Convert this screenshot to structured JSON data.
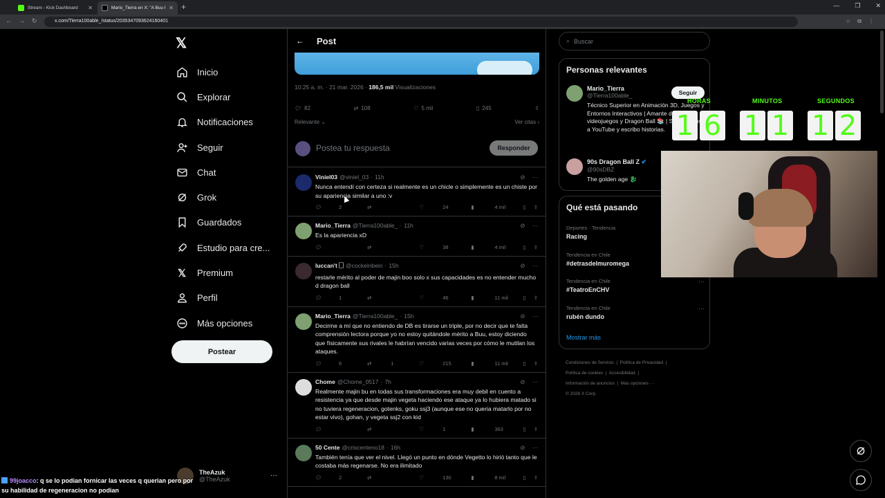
{
  "browser": {
    "tabs": [
      {
        "title": "Stream - Kick Dashboard",
        "favicon_color": "#53fc18"
      },
      {
        "title": "Mario_Tierra en X: \"A Buu le h",
        "favicon_color": "#000000"
      }
    ],
    "url": "x.com/Tierra100able_/status/2035347093624160401"
  },
  "nav": {
    "items": [
      {
        "label": "Inicio",
        "icon": "home-icon"
      },
      {
        "label": "Explorar",
        "icon": "search-icon"
      },
      {
        "label": "Notificaciones",
        "icon": "bell-icon"
      },
      {
        "label": "Seguir",
        "icon": "follow-icon"
      },
      {
        "label": "Chat",
        "icon": "mail-icon"
      },
      {
        "label": "Grok",
        "icon": "grok-icon"
      },
      {
        "label": "Guardados",
        "icon": "bookmark-icon"
      },
      {
        "label": "Estudio para cre...",
        "icon": "rocket-icon"
      },
      {
        "label": "Premium",
        "icon": "x-icon"
      },
      {
        "label": "Perfil",
        "icon": "person-icon"
      },
      {
        "label": "Más opciones",
        "icon": "more-circle-icon"
      }
    ],
    "post_button": "Postear",
    "profile": {
      "name": "TheAzuk",
      "handle": "@TheAzuk"
    }
  },
  "post": {
    "header": "Post",
    "time": "10:25 a. m. · 21 mar. 2026 · ",
    "views_count": "186,5 mil",
    "views_label": " Visualizaciones",
    "stats": {
      "replies": "82",
      "reposts": "108",
      "likes": "5 mil",
      "bookmarks": "245"
    },
    "sort": "Relevante",
    "quotes": "Ver citas",
    "reply_placeholder": "Postea tu respuesta",
    "reply_button": "Responder"
  },
  "replies": [
    {
      "name": "Viniel03",
      "handle": "@viniel_03",
      "time": "11h",
      "text": "Nunca entendí con certeza si realmente es un chicle o simplemente es un chiste por su apariencia similar a uno :v",
      "replies": "2",
      "reposts": "",
      "likes": "24",
      "views": "4 mil",
      "avatar_color": "#1a2a6a"
    },
    {
      "name": "Mario_Tierra",
      "handle": "@Tierra100able_",
      "time": "11h",
      "text": "Es la apariencia xD",
      "replies": "",
      "reposts": "",
      "likes": "38",
      "views": "4 mil",
      "avatar_color": "#7fa070"
    },
    {
      "name": "luccan't 🗌",
      "handle": "@cockeinbein",
      "time": "15h",
      "text": "restarle mérito al poder de majin boo solo x sus capacidades es no entender mucho d dragon ball",
      "replies": "1",
      "reposts": "",
      "likes": "46",
      "views": "11 mil",
      "avatar_color": "#3a2a30"
    },
    {
      "name": "Mario_Tierra",
      "handle": "@Tierra100able_",
      "time": "15h",
      "text": "Decirme a mí que no entiendo de DB es tirarse un triple, por no decir que te falta comprensión lectora porque yo no estoy quitándole mérito a Buu, estoy diciendo que físicamente sus rivales le habrían vencido varias veces por cómo le mutilan los ataques.",
      "replies": "6",
      "reposts": "1",
      "likes": "215",
      "views": "11 mil",
      "avatar_color": "#7fa070"
    },
    {
      "name": "Chome",
      "handle": "@Chome_0517",
      "time": "7h",
      "text": "Realmente majin bu en todas sus transformaciones era muy debil en cuento a resistencia ya que desde majin vegeta haciendo ese ataque ya lo hubiera matado si no tuviera regeneracion, gotenks, goku ssj3 (aunque ese no queria matarlo por no estar vivo), gohan, y vegeta ssj2 con kid",
      "replies": "",
      "reposts": "",
      "likes": "1",
      "views": "363",
      "avatar_color": "#ddd"
    },
    {
      "name": "50 Cente",
      "handle": "@criscenteno18",
      "time": "16h",
      "text": "También tenía que ver el nivel. Llegó un punto en dónde Vegetto lo hirió tanto que le costaba más regenarse. No era ilimitado",
      "replies": "2",
      "reposts": "",
      "likes": "130",
      "views": "8 mil",
      "avatar_color": "#5a7a5a"
    }
  ],
  "sidebar": {
    "search_placeholder": "Buscar",
    "relevant_title": "Personas relevantes",
    "people": [
      {
        "name": "Mario_Tierra",
        "handle": "@Tierra100able_",
        "follow": "Seguir",
        "bio": "Técnico Superior en Animación 3D, Juegos y Entornos Interactivos | Amante de los videojuegos y Dragon Ball 📚 | Subo vídeos a YouTube y escribo historias."
      },
      {
        "name": "90s Dragon Ball Z",
        "handle": "@90sDBZ",
        "bio": "The golden age 🐉"
      }
    ],
    "trends_title": "Qué está pasando",
    "trends": [
      {
        "context": "Deportes · Tendencia",
        "name": "Racing"
      },
      {
        "context": "Tendencia en Chile",
        "name": "#detrasdelmuromega"
      },
      {
        "context": "Tendencia en Chile",
        "name": "#TeatroEnCHV"
      },
      {
        "context": "Tendencia en Chile",
        "name": "rubén dundo"
      }
    ],
    "show_more": "Mostrar más",
    "footer": [
      "Condiciones de Servicio",
      "Política de Privacidad",
      "Política de cookies",
      "Accesibilidad",
      "Información de anuncios",
      "Más opciones ···",
      "© 2026 X Corp."
    ]
  },
  "timer": {
    "labels": [
      "HORAS",
      "MINUTOS",
      "SEGUNDOS"
    ],
    "digits": [
      "1",
      "6",
      "1",
      "1",
      "1",
      "2"
    ],
    "color": "#53fc18"
  },
  "chat": {
    "user": "99joacco",
    "message": ": q se lo podian fornicar las veces q querian pero por su habilidad de regeneracion no podian"
  }
}
